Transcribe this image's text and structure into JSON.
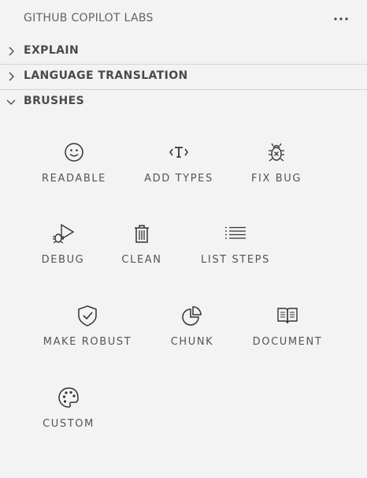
{
  "header": {
    "title": "GITHUB COPILOT LABS"
  },
  "sections": {
    "explain": {
      "label": "EXPLAIN",
      "expanded": false
    },
    "translation": {
      "label": "LANGUAGE TRANSLATION",
      "expanded": false
    },
    "brushes": {
      "label": "BRUSHES",
      "expanded": true
    }
  },
  "brushes": [
    {
      "label": "READABLE",
      "icon": "smiley-icon"
    },
    {
      "label": "ADD TYPES",
      "icon": "type-hierarchy-icon"
    },
    {
      "label": "FIX BUG",
      "icon": "bug-icon"
    },
    {
      "label": "DEBUG",
      "icon": "debug-icon"
    },
    {
      "label": "CLEAN",
      "icon": "trash-icon"
    },
    {
      "label": "LIST STEPS",
      "icon": "list-icon"
    },
    {
      "label": "MAKE ROBUST",
      "icon": "shield-icon"
    },
    {
      "label": "CHUNK",
      "icon": "pie-chart-icon"
    },
    {
      "label": "DOCUMENT",
      "icon": "book-icon"
    },
    {
      "label": "CUSTOM",
      "icon": "palette-icon"
    }
  ],
  "colors": {
    "background": "#f3f3f3",
    "divider": "#d4d4d4",
    "text": "#4a4a4a"
  }
}
